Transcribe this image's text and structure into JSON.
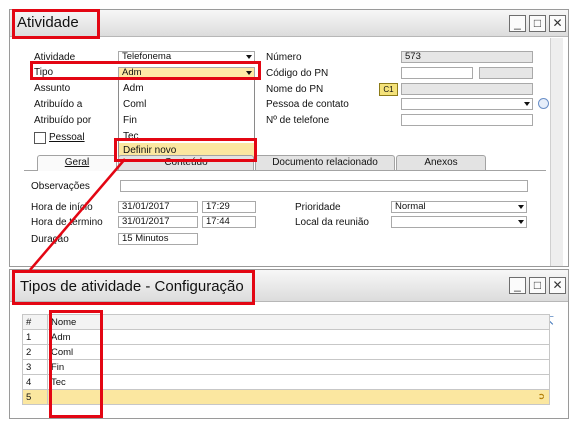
{
  "top_window": {
    "title": "Atividade",
    "buttons": {
      "minimize": "_",
      "maximize": "□",
      "close": "✕"
    },
    "fields_left": [
      {
        "label": "Atividade",
        "value": "Telefonema"
      },
      {
        "label": "Tipo",
        "value": "Adm"
      },
      {
        "label": "Assunto",
        "value": ""
      },
      {
        "label": "Atribuído a",
        "value": ""
      },
      {
        "label": "Atribuído por",
        "value": ""
      }
    ],
    "pessoal_label": "Pessoal",
    "fields_right": [
      {
        "label": "Número",
        "value": "573"
      },
      {
        "label": "Código do PN",
        "value": ""
      },
      {
        "label": "Nome do PN",
        "value": ""
      },
      {
        "label": "Pessoa de contato",
        "value": ""
      },
      {
        "label": "Nº de telefone",
        "value": ""
      }
    ],
    "bp_badge": "C1",
    "dropdown_items": [
      "Adm",
      "Coml",
      "Fin",
      "Tec",
      "Definir novo"
    ],
    "tabs": [
      "Geral",
      "Conteúdo",
      "Documento relacionado",
      "Anexos"
    ],
    "general": {
      "observacoes_label": "Observações",
      "hora_inicio_label": "Hora de início",
      "hora_inicio_date": "31/01/2017",
      "hora_inicio_time": "17:29",
      "hora_termino_label": "Hora de término",
      "hora_termino_date": "31/01/2017",
      "hora_termino_time": "17:44",
      "duracao_label": "Duração",
      "duracao_value": "15 Minutos",
      "prioridade_label": "Prioridade",
      "prioridade_value": "Normal",
      "local_label": "Local da reunião",
      "local_value": ""
    }
  },
  "bottom_window": {
    "title": "Tipos de atividade - Configuração",
    "buttons": {
      "minimize": "_",
      "maximize": "□",
      "close": "✕"
    },
    "columns": [
      "#",
      "Nome"
    ],
    "rows": [
      {
        "num": "1",
        "name": "Adm"
      },
      {
        "num": "2",
        "name": "Coml"
      },
      {
        "num": "3",
        "name": "Fin"
      },
      {
        "num": "4",
        "name": "Tec"
      },
      {
        "num": "5",
        "name": ""
      }
    ]
  }
}
